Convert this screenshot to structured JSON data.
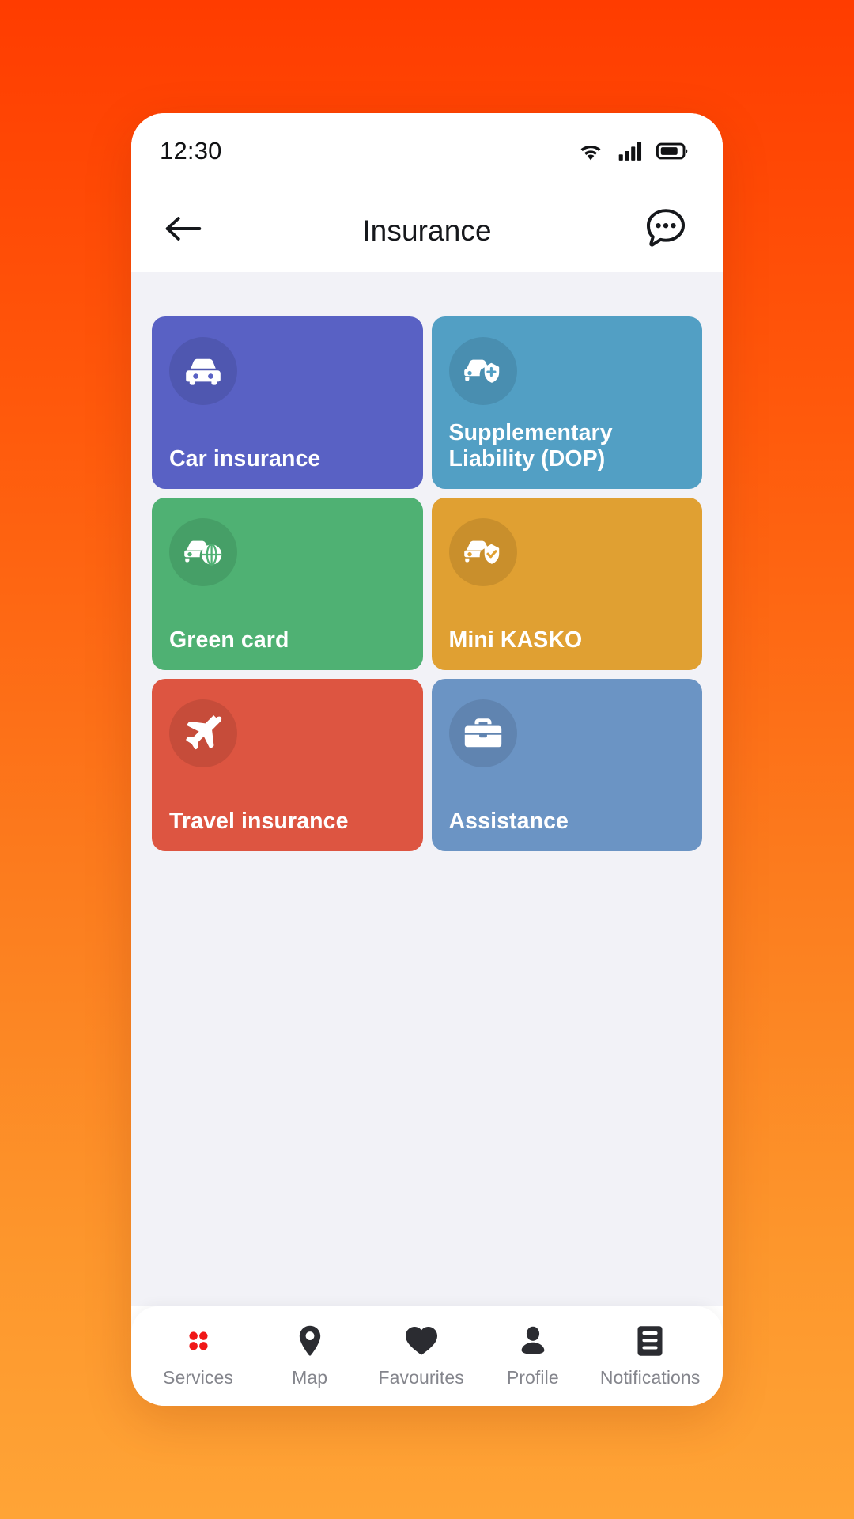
{
  "theme": {
    "bg_gradient_top": "#FF3C00",
    "bg_gradient_bottom": "#FFA436",
    "screen_bg": "#F2F2F7",
    "phone_bg": "#FFFFFF",
    "accent_red": "#F01818",
    "nav_label_color": "#84858C"
  },
  "statusbar": {
    "time": "12:30",
    "icons": [
      "wifi-icon",
      "cellular-signal-icon",
      "battery-icon"
    ]
  },
  "header": {
    "back_icon": "arrow-left-icon",
    "title": "Insurance",
    "action_icon": "chat-dots-icon"
  },
  "main": {
    "cards": [
      {
        "label": "Car insurance",
        "icon": "car-front-icon",
        "color": "#5961C4",
        "badge_color": "rgba(0,0,0,0.10)"
      },
      {
        "label": "Supplementary\nLiability (DOP)",
        "icon": "car-shield-plus-icon",
        "color": "#529FC4",
        "badge_color": "rgba(0,0,0,0.10)"
      },
      {
        "label": "Green card",
        "icon": "car-globe-icon",
        "color": "#4FB173",
        "badge_color": "rgba(0,0,0,0.10)"
      },
      {
        "label": "Mini KASKO",
        "icon": "car-shield-check-icon",
        "color": "#E0A032",
        "badge_color": "rgba(0,0,0,0.10)"
      },
      {
        "label": "Travel insurance",
        "icon": "airplane-icon",
        "color": "#DD5541",
        "badge_color": "rgba(0,0,0,0.10)"
      },
      {
        "label": "Assistance",
        "icon": "briefcase-icon",
        "color": "#6B94C4",
        "badge_color": "rgba(0,0,0,0.10)"
      }
    ]
  },
  "bottomnav": {
    "items": [
      {
        "label": "Services",
        "icon": "four-dots-grid-icon",
        "active": true
      },
      {
        "label": "Map",
        "icon": "location-pin-icon",
        "active": false
      },
      {
        "label": "Favourites",
        "icon": "heart-icon",
        "active": false
      },
      {
        "label": "Profile",
        "icon": "person-icon",
        "active": false
      },
      {
        "label": "Notifications",
        "icon": "list-document-icon",
        "active": false
      }
    ]
  }
}
